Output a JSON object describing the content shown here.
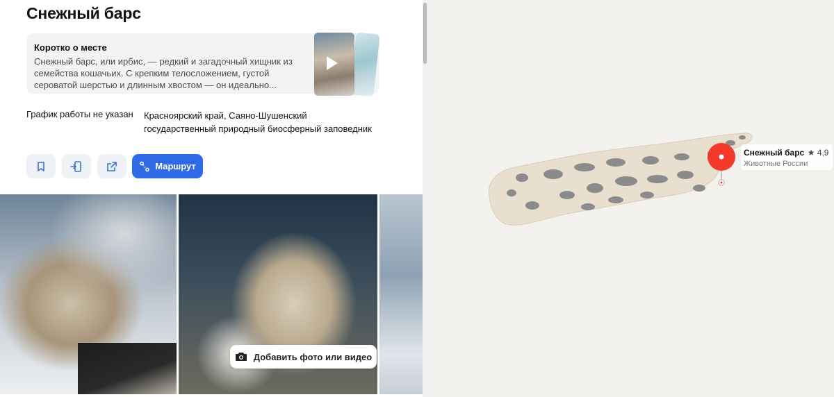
{
  "place": {
    "title": "Снежный барс",
    "about": {
      "heading": "Коротко о месте",
      "text": "Снежный барс, или ирбис, — редкий и загадочный хищник из семейства кошачьих. С крепким телосложением, густой сероватой шерстью и длинным хвостом — он идеально..."
    },
    "hours": "График работы не указан",
    "address": "Красноярский край, Саяно-Шушенский государственный природный биосферный заповедник",
    "actions": {
      "bookmark_icon": "bookmark-icon",
      "send_to_phone_icon": "phone-send-icon",
      "share_icon": "share-icon",
      "route_label": "Маршрут",
      "route_icon": "route-icon"
    },
    "add_photo_label": "Добавить фото или видео"
  },
  "map": {
    "marker": {
      "name": "Снежный барс",
      "rating": "★ 4,9",
      "category": "Животные России"
    }
  },
  "colors": {
    "accent": "#2f6be6",
    "pin": "#f33a2a",
    "leopard_fur": "#e9dfcf",
    "leopard_spots": "#8b8b8b"
  }
}
